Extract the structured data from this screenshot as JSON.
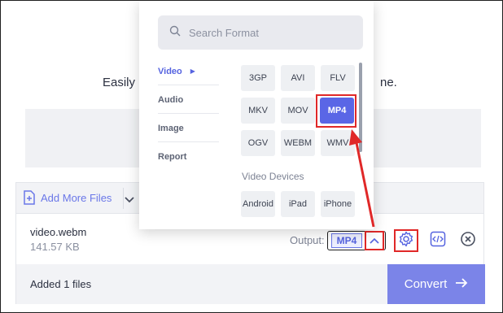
{
  "tagline": {
    "left": "Easily",
    "right": "ne."
  },
  "files_panel": {
    "add_more_label": "Add More Files",
    "file": {
      "name": "video.webm",
      "size": "141.57 KB"
    },
    "output_label": "Output:",
    "output_value": "MP4",
    "added_count": "Added 1 files",
    "convert_label": "Convert"
  },
  "format_dropdown": {
    "search_placeholder": "Search Format",
    "categories": [
      {
        "label": "Video",
        "active": true
      },
      {
        "label": "Audio",
        "active": false
      },
      {
        "label": "Image",
        "active": false
      },
      {
        "label": "Report",
        "active": false
      }
    ],
    "formats": [
      "3GP",
      "AVI",
      "FLV",
      "MKV",
      "MOV",
      "MP4",
      "OGV",
      "WEBM",
      "WMV"
    ],
    "selected_format": "MP4",
    "devices_label": "Video Devices",
    "devices": [
      "Android",
      "iPad",
      "iPhone"
    ]
  },
  "colors": {
    "accent": "#5a66e6",
    "convert_button": "#7b84e8",
    "annotation": "#e02828"
  },
  "icons": {
    "search": "search-icon",
    "add_file": "file-plus-icon",
    "dropdown": "chevron-down-icon",
    "output_toggle": "chevron-up-icon",
    "settings": "gear-icon",
    "embed": "code-icon",
    "remove": "close-circle-icon",
    "convert": "arrow-right-icon"
  }
}
